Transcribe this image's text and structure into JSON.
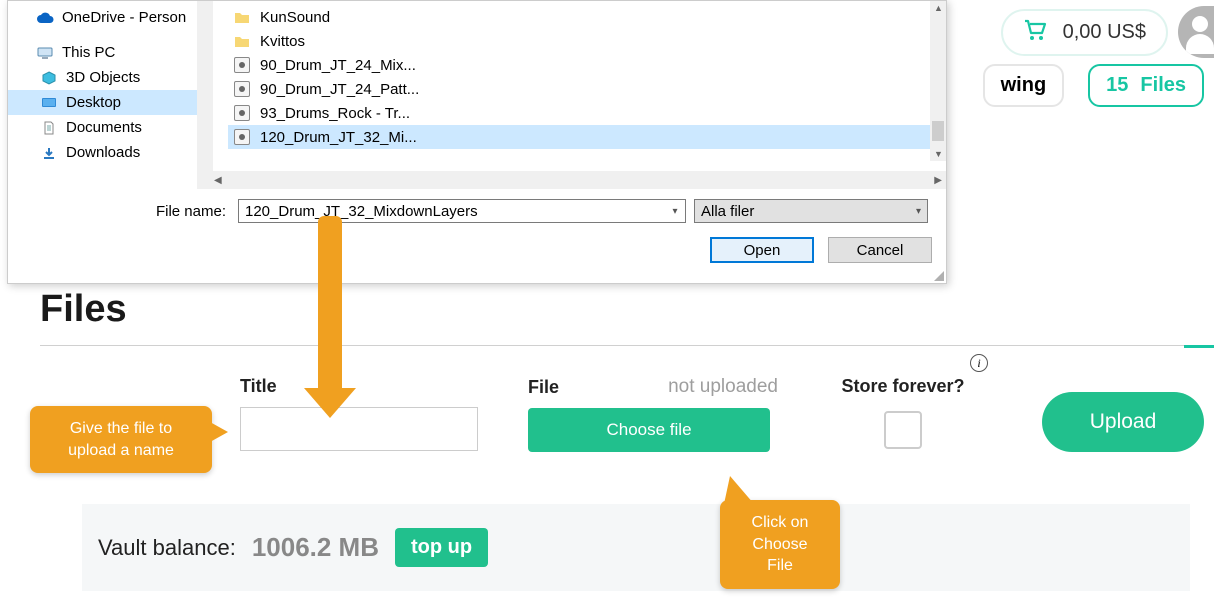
{
  "header": {
    "cart_total": "0,00 US$"
  },
  "pills": {
    "partial_label": "wing",
    "files_count": "15",
    "files_label": "Files"
  },
  "dialog": {
    "nav": {
      "onedrive": "OneDrive - Person",
      "this_pc": "This PC",
      "objects3d": "3D Objects",
      "desktop": "Desktop",
      "documents": "Documents",
      "downloads": "Downloads"
    },
    "files": [
      {
        "name": "KunSound",
        "type": "folder"
      },
      {
        "name": "Kvittos",
        "type": "folder"
      },
      {
        "name": "90_Drum_JT_24_Mix...",
        "type": "audio"
      },
      {
        "name": "90_Drum_JT_24_Patt...",
        "type": "audio"
      },
      {
        "name": "93_Drums_Rock - Tr...",
        "type": "audio"
      },
      {
        "name": "120_Drum_JT_32_Mi...",
        "type": "audio",
        "selected": true
      }
    ],
    "filename_label": "File name:",
    "filename_value": "120_Drum_JT_32_MixdownLayers",
    "filetype": "Alla filer",
    "open_btn": "Open",
    "cancel_btn": "Cancel"
  },
  "page": {
    "title": "Files",
    "form": {
      "title_label": "Title",
      "file_label": "File",
      "not_uploaded": "not uploaded",
      "choose_file": "Choose file",
      "store_label": "Store forever?",
      "upload": "Upload"
    },
    "vault": {
      "label": "Vault balance:",
      "value": "1006.2 MB",
      "topup": "top up"
    }
  },
  "callouts": {
    "c1_line1": "Give the file to",
    "c1_line2": "upload a name",
    "c2_line1": "Click on",
    "c2_line2": "Choose File"
  }
}
